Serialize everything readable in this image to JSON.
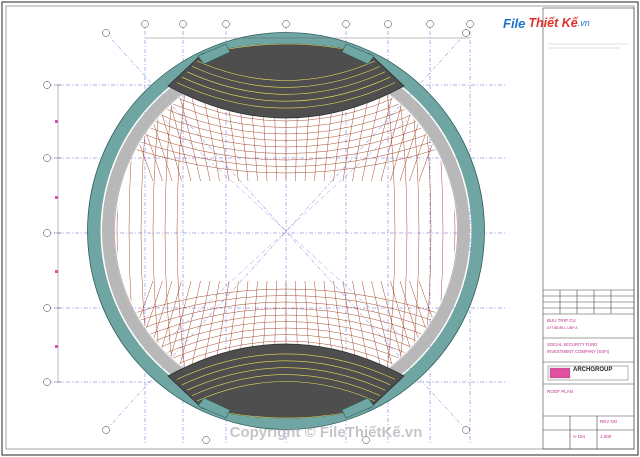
{
  "logo": {
    "brand_file": "File",
    "brand_rest": "Thiết Kế",
    "brand_domain": ".vn"
  },
  "title_block": {
    "client_line1": "BUU TRIP CU",
    "client_line2": "AYTIBDRLL UBP A",
    "company_line1": "SOCIAL SECURITY FUND",
    "company_line2": "INVESTMENT COMPANY (SSFI)",
    "firm_name": "ARCHGROUP",
    "drawing_title": "ROOF PLAN",
    "rev_label": "REV NO",
    "sheet_no": "A-104",
    "scale": "1:200"
  },
  "watermark": {
    "copyright_text": "Copyright © FileThiếtKế.vn"
  },
  "colors": {
    "border": "#4a4a4a",
    "grid": "#3b3bd6",
    "ring_outer": "#6fa5a3",
    "ring_inner": "#b8b8b8",
    "mesh": "#9b3a1a",
    "roof_fill": "#4e4e4e",
    "roof_line": "#e8e05a",
    "title_accent": "#d0389a"
  }
}
